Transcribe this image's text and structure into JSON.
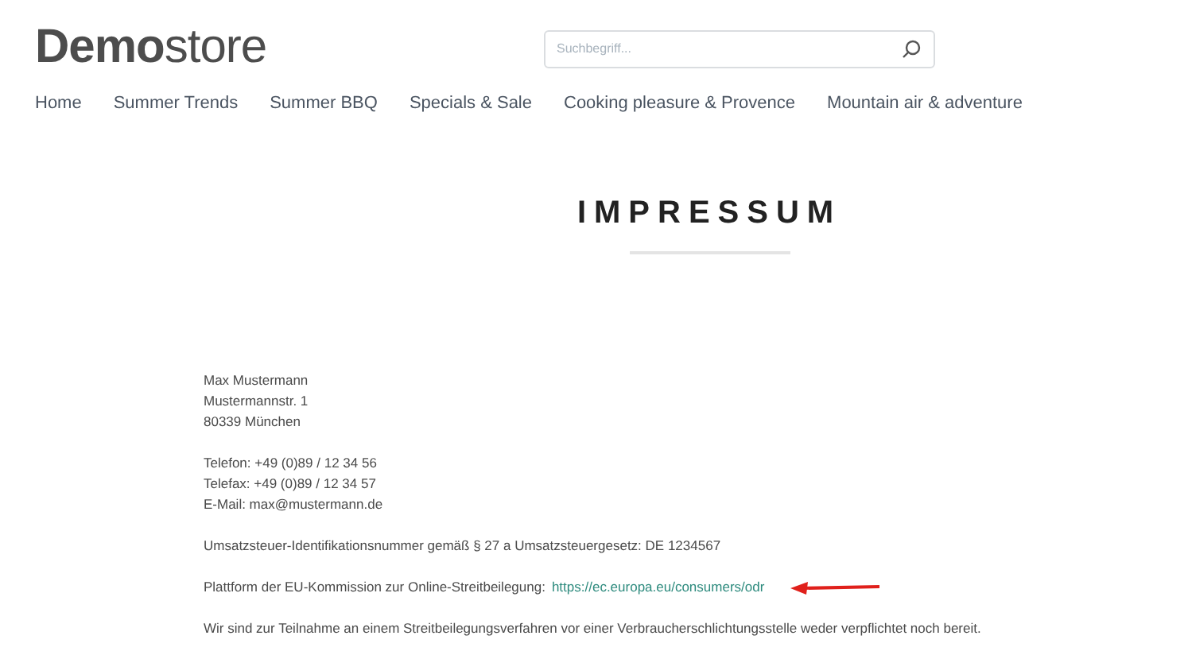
{
  "logo": {
    "bold": "Demo",
    "light": "store"
  },
  "search": {
    "placeholder": "Suchbegriff..."
  },
  "nav": [
    {
      "label": "Home"
    },
    {
      "label": "Summer Trends"
    },
    {
      "label": "Summer BBQ"
    },
    {
      "label": "Specials & Sale"
    },
    {
      "label": "Cooking pleasure & Provence"
    },
    {
      "label": "Mountain air & adventure"
    }
  ],
  "page_title": "IMPRESSUM",
  "content": [
    {
      "lines": [
        "Max Mustermann",
        "Mustermannstr. 1",
        "80339 München"
      ]
    },
    {
      "lines": [
        "Telefon: +49 (0)89 / 12 34 56",
        "Telefax: +49 (0)89 / 12 34 57",
        "E-Mail: max@mustermann.de"
      ]
    },
    {
      "lines": [
        "Umsatzsteuer-Identifikationsnummer gemäß § 27 a Umsatzsteuergesetz: DE 1234567"
      ]
    },
    {
      "lines": [
        "Plattform der EU-Kommission zur Online-Streitbeilegung:"
      ],
      "link": "https://ec.europa.eu/consumers/odr",
      "annotated": true
    },
    {
      "lines": [
        "Wir sind zur Teilnahme an einem Streitbeilegungsverfahren vor einer Verbraucherschlichtungsstelle weder verpflichtet noch bereit."
      ]
    }
  ]
}
